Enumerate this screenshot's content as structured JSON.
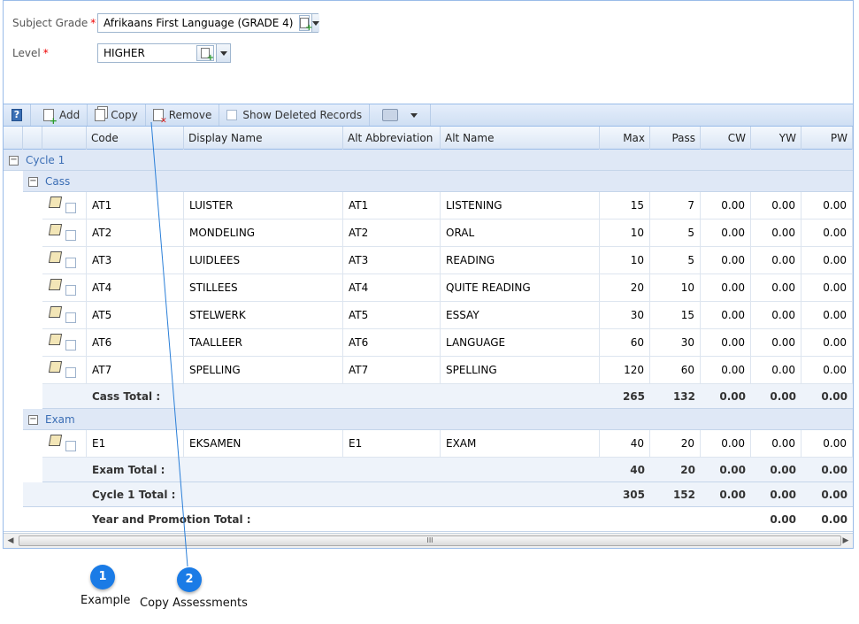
{
  "form": {
    "subject_grade": {
      "label": "Subject Grade",
      "required_mark": "*",
      "value": "Afrikaans First Language (GRADE 4)"
    },
    "level": {
      "label": "Level",
      "required_mark": "*",
      "value": "HIGHER"
    }
  },
  "toolbar": {
    "help_label": "?",
    "add_label": "Add",
    "copy_label": "Copy",
    "remove_label": "Remove",
    "show_deleted_label": "Show Deleted Records"
  },
  "grid": {
    "columns": [
      "Code",
      "Display Name",
      "Alt Abbreviation",
      "Alt Name",
      "Max",
      "Pass",
      "CW",
      "YW",
      "PW"
    ],
    "cycle_label": "Cycle 1",
    "groups": [
      {
        "label": "Cass",
        "rows": [
          [
            "AT1",
            "LUISTER",
            "AT1",
            "LISTENING",
            "15",
            "7",
            "0.00",
            "0.00",
            "0.00"
          ],
          [
            "AT2",
            "MONDELING",
            "AT2",
            "ORAL",
            "10",
            "5",
            "0.00",
            "0.00",
            "0.00"
          ],
          [
            "AT3",
            "LUIDLEES",
            "AT3",
            "READING",
            "10",
            "5",
            "0.00",
            "0.00",
            "0.00"
          ],
          [
            "AT4",
            "STILLEES",
            "AT4",
            "QUITE READING",
            "20",
            "10",
            "0.00",
            "0.00",
            "0.00"
          ],
          [
            "AT5",
            "STELWERK",
            "AT5",
            "ESSAY",
            "30",
            "15",
            "0.00",
            "0.00",
            "0.00"
          ],
          [
            "AT6",
            "TAALLEER",
            "AT6",
            "LANGUAGE",
            "60",
            "30",
            "0.00",
            "0.00",
            "0.00"
          ],
          [
            "AT7",
            "SPELLING",
            "AT7",
            "SPELLING",
            "120",
            "60",
            "0.00",
            "0.00",
            "0.00"
          ]
        ],
        "total": {
          "label": "Cass Total :",
          "max": "265",
          "pass": "132",
          "cw": "0.00",
          "yw": "0.00",
          "pw": "0.00"
        }
      },
      {
        "label": "Exam",
        "rows": [
          [
            "E1",
            "EKSAMEN",
            "E1",
            "EXAM",
            "40",
            "20",
            "0.00",
            "0.00",
            "0.00"
          ]
        ],
        "total": {
          "label": "Exam Total :",
          "max": "40",
          "pass": "20",
          "cw": "0.00",
          "yw": "0.00",
          "pw": "0.00"
        }
      }
    ],
    "cycle_total": {
      "label": "Cycle 1 Total :",
      "max": "305",
      "pass": "152",
      "cw": "0.00",
      "yw": "0.00",
      "pw": "0.00"
    },
    "year_total": {
      "label": "Year and Promotion Total :",
      "yw": "0.00",
      "pw": "0.00"
    },
    "scroll_grip": "III"
  },
  "callouts": [
    {
      "number": "1",
      "label": "Example"
    },
    {
      "number": "2",
      "label": "Copy Assessments"
    }
  ],
  "colors": {
    "accent": "#1a7be6",
    "group_text": "#3b6eb5",
    "header_bg": "#dbe6f5"
  }
}
